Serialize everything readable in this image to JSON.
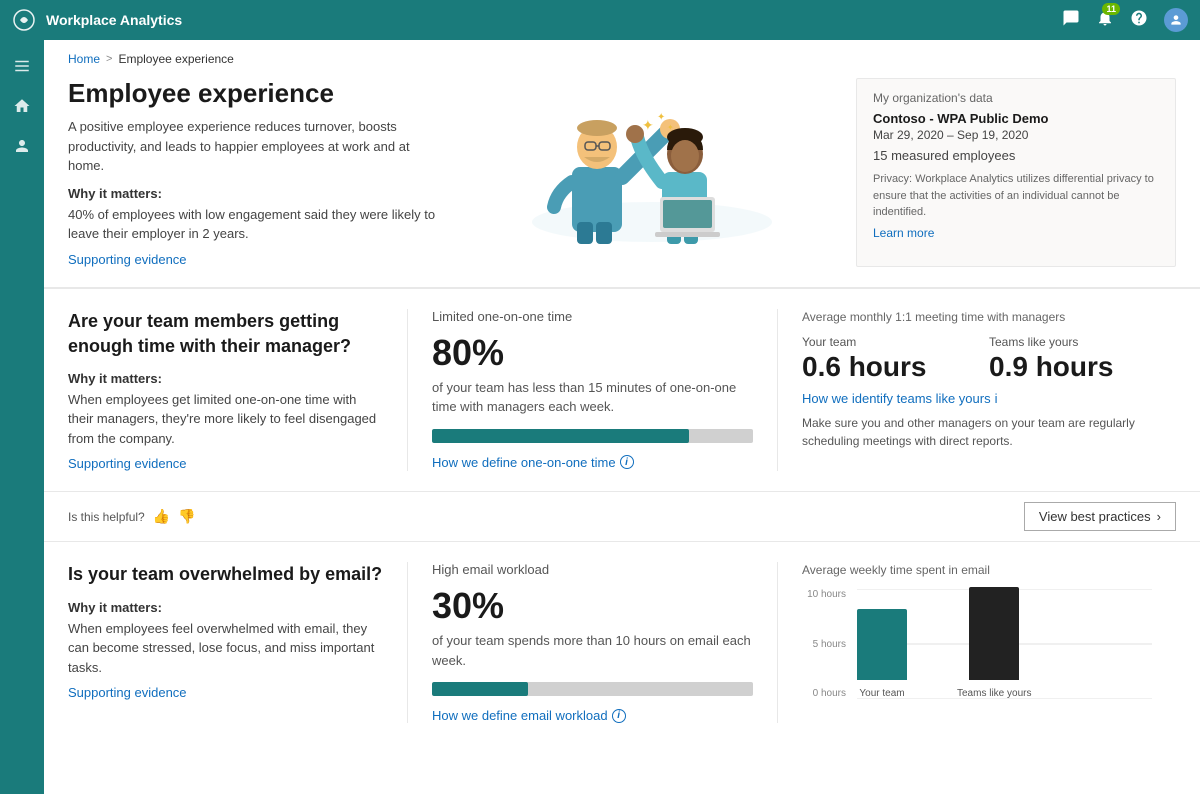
{
  "topbar": {
    "title": "Workplace Analytics",
    "notification_count": "11"
  },
  "breadcrumb": {
    "home": "Home",
    "separator": ">",
    "current": "Employee experience"
  },
  "hero": {
    "title": "Employee experience",
    "description": "A positive employee experience reduces turnover, boosts productivity, and leads to happier employees at work and at home.",
    "why_matters_label": "Why it matters:",
    "why_matters_text": "40% of employees with low engagement said they were likely to leave their employer in 2 years.",
    "supporting_evidence": "Supporting evidence"
  },
  "org_data": {
    "section_title": "My organization's data",
    "org_name": "Contoso - WPA Public Demo",
    "date_range": "Mar 29, 2020 – Sep 19, 2020",
    "employees": "15 measured employees",
    "privacy_text": "Privacy: Workplace Analytics utilizes differential privacy to ensure that the activities of an individual cannot be indentified.",
    "learn_more": "Learn more"
  },
  "card1": {
    "question": "Are your team members getting enough time with their manager?",
    "why_matters_label": "Why it matters:",
    "why_matters_text": "When employees get limited one-on-one time with their managers, they're more likely to feel disengaged from the company.",
    "supporting_evidence": "Supporting evidence",
    "stat_label": "Limited one-on-one time",
    "stat_value": "80%",
    "stat_desc": "of your team has less than 15 minutes of one-on-one time with managers each week.",
    "progress_percent": 80,
    "define_link": "How we define one-on-one time",
    "comparison_title": "Average monthly 1:1 meeting time with managers",
    "your_team_label": "Your team",
    "your_team_value": "0.6 hours",
    "teams_like_yours_label": "Teams like yours",
    "teams_like_yours_value": "0.9 hours",
    "identify_link": "How we identify teams like yours",
    "identify_desc": "Make sure you and other managers on your team are regularly scheduling meetings with direct reports."
  },
  "feedback1": {
    "helpful_label": "Is this helpful?",
    "view_best_practices": "View best practices"
  },
  "card2": {
    "question": "Is your team overwhelmed by email?",
    "why_matters_label": "Why it matters:",
    "why_matters_text": "When employees feel overwhelmed with email, they can become stressed, lose focus, and miss important tasks.",
    "supporting_evidence": "Supporting evidence",
    "stat_label": "High email workload",
    "stat_value": "30%",
    "stat_desc": "of your team spends more than 10 hours on email each week.",
    "progress_percent": 30,
    "define_link": "How we define email workload",
    "comparison_title": "Average weekly time spent in email",
    "your_team_label": "Your team",
    "your_team_hours": 6.5,
    "teams_like_yours_label": "Teams like yours",
    "teams_like_yours_hours": 8.5,
    "chart_y_labels": [
      "10 hours",
      "5 hours",
      "0 hours"
    ]
  },
  "colors": {
    "teal": "#1a7b7b",
    "link_blue": "#106ebe",
    "bar_teal": "#1a7b7b",
    "bar_dark": "#333333",
    "progress_fill": "#1a7b7b",
    "progress_bg": "#d0d0d0"
  }
}
